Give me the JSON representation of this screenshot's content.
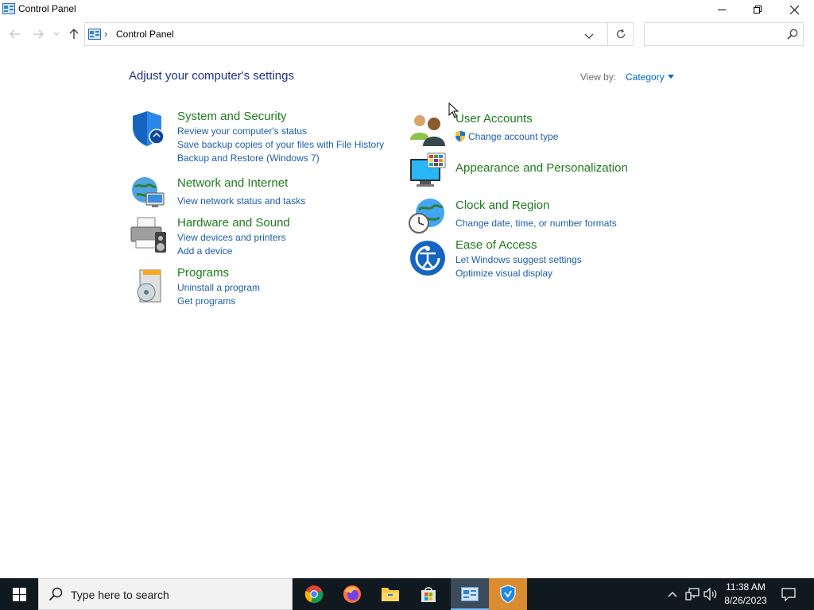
{
  "window": {
    "title": "Control Panel"
  },
  "address": {
    "path": "Control Panel",
    "separator": "›",
    "search_placeholder": ""
  },
  "main": {
    "heading": "Adjust your computer's settings",
    "view_by_label": "View by:",
    "view_by_value": "Category",
    "categories": [
      {
        "title": "System and Security",
        "icon": "shield-icon",
        "links": [
          "Review your computer's status",
          "Save backup copies of your files with File History",
          "Backup and Restore (Windows 7)"
        ]
      },
      {
        "title": "Network and Internet",
        "icon": "network-globe-icon",
        "links": [
          "View network status and tasks"
        ]
      },
      {
        "title": "Hardware and Sound",
        "icon": "printer-speaker-icon",
        "links": [
          "View devices and printers",
          "Add a device"
        ]
      },
      {
        "title": "Programs",
        "icon": "programs-box-icon",
        "links": [
          "Uninstall a program",
          "Get programs"
        ]
      },
      {
        "title": "User Accounts",
        "icon": "users-icon",
        "links": [
          "Change account type"
        ]
      },
      {
        "title": "Appearance and Personalization",
        "icon": "monitor-palette-icon",
        "links": []
      },
      {
        "title": "Clock and Region",
        "icon": "clock-globe-icon",
        "links": [
          "Change date, time, or number formats"
        ]
      },
      {
        "title": "Ease of Access",
        "icon": "ease-of-access-icon",
        "links": [
          "Let Windows suggest settings",
          "Optimize visual display"
        ]
      }
    ]
  },
  "taskbar": {
    "search_placeholder": "Type here to search",
    "apps": [
      "chrome-icon",
      "firefox-icon",
      "file-explorer-icon",
      "microsoft-store-icon",
      "control-panel-icon",
      "security-app-icon"
    ],
    "time": "11:38 AM",
    "date": "8/26/2023"
  },
  "colors": {
    "heading": "#1e3287",
    "category_title": "#1e7b1e",
    "link": "#1e5ea8",
    "taskbar": "#101820"
  }
}
